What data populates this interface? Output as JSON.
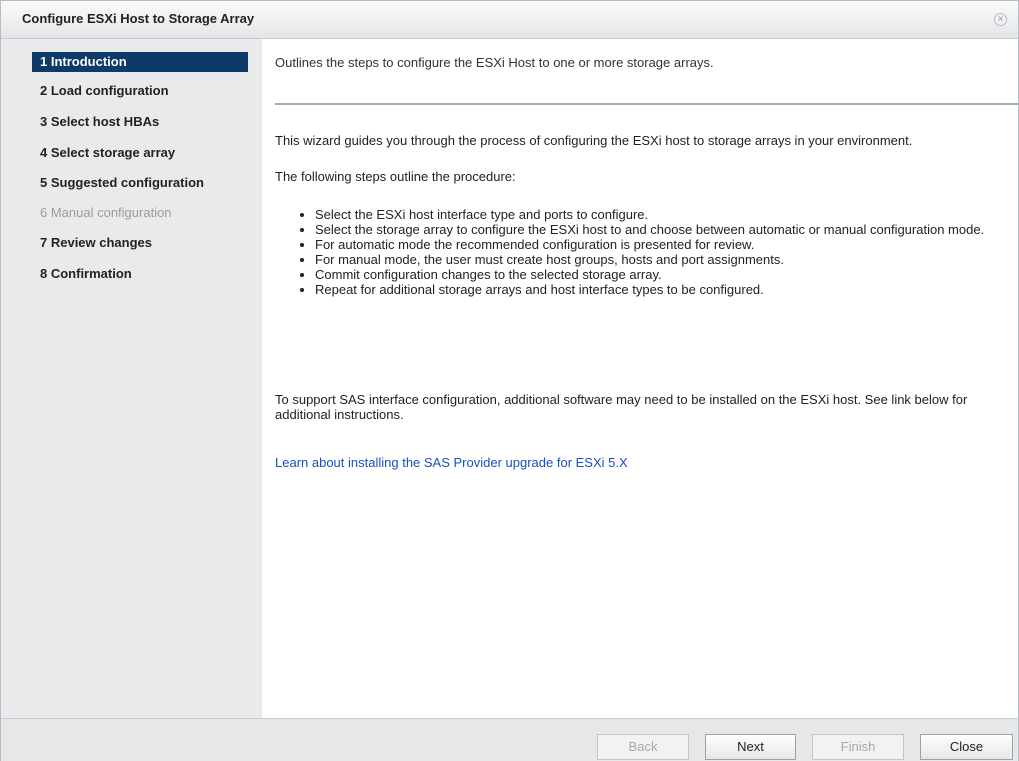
{
  "window": {
    "title": "Configure ESXi Host to Storage Array",
    "close_icon": "close-icon"
  },
  "steps": [
    {
      "label": "1 Introduction",
      "state": "active"
    },
    {
      "label": "2 Load configuration",
      "state": "enabled"
    },
    {
      "label": "3 Select host HBAs",
      "state": "enabled"
    },
    {
      "label": "4 Select storage array",
      "state": "enabled"
    },
    {
      "label": "5 Suggested configuration",
      "state": "enabled"
    },
    {
      "label": "6 Manual configuration",
      "state": "disabled"
    },
    {
      "label": "7 Review changes",
      "state": "enabled"
    },
    {
      "label": "8 Confirmation",
      "state": "enabled"
    }
  ],
  "content": {
    "summary": "Outlines the steps to configure the ESXi Host to one or more storage arrays.",
    "intro": "This wizard guides you through the process of configuring the ESXi host to storage arrays in your environment.",
    "steps_intro": "The following steps outline the procedure:",
    "bullets": [
      "Select the ESXi host interface type and ports to configure.",
      "Select the storage array to configure the ESXi host to and choose between automatic or manual configuration mode.",
      "For automatic mode the recommended configuration is presented for review.",
      "For manual mode, the user must create host groups, hosts and port assignments.",
      "Commit configuration changes to the selected storage array.",
      "Repeat for additional storage arrays and host interface types to be configured."
    ],
    "sas_note": "To support SAS interface configuration, additional software may need to be installed on the ESXi host. See link below for additional instructions.",
    "sas_link": "Learn about installing the SAS Provider upgrade for ESXi 5.X"
  },
  "footer": {
    "back": "Back",
    "next": "Next",
    "finish": "Finish",
    "close": "Close"
  },
  "colors": {
    "active_step_bg": "#0d3a66",
    "link": "#1a4fc1",
    "sidebar_bg": "#e9eaeb"
  }
}
